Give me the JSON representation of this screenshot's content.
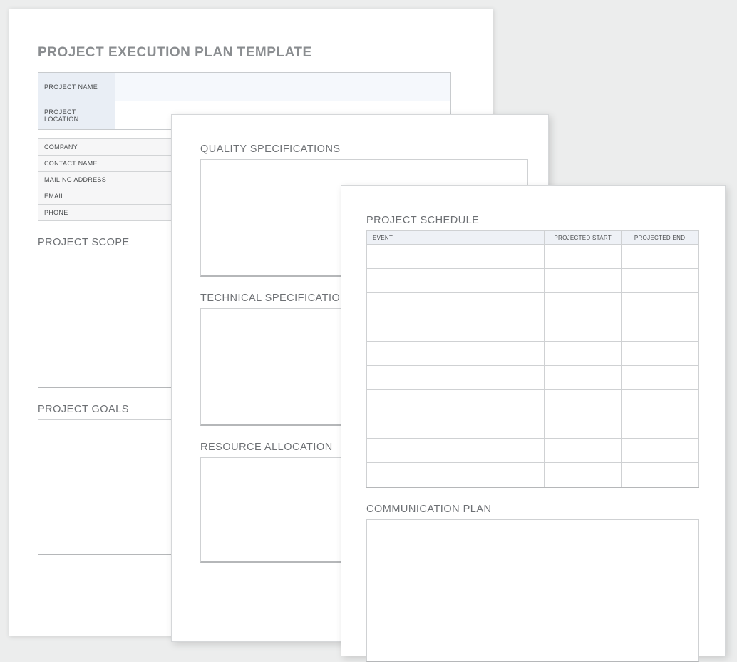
{
  "page1": {
    "title": "PROJECT EXECUTION PLAN TEMPLATE",
    "info": {
      "project_name_label": "PROJECT NAME",
      "project_name_value": "",
      "project_location_label": "PROJECT LOCATION",
      "project_location_value": ""
    },
    "contact": {
      "company_label": "COMPANY",
      "company_value": "",
      "contact_name_label": "CONTACT NAME",
      "contact_name_value": "",
      "mailing_address_label": "MAILING ADDRESS",
      "mailing_address_value": "",
      "email_label": "EMAIL",
      "email_value": "",
      "phone_label": "PHONE",
      "phone_value": ""
    },
    "scope_heading": "PROJECT SCOPE",
    "goals_heading": "PROJECT GOALS"
  },
  "page2": {
    "quality_heading": "QUALITY SPECIFICATIONS",
    "technical_heading": "TECHNICAL SPECIFICATIONS",
    "resource_heading": "RESOURCE ALLOCATION"
  },
  "page3": {
    "schedule_heading": "PROJECT SCHEDULE",
    "schedule_cols": {
      "event": "EVENT",
      "start": "PROJECTED START",
      "end": "PROJECTED END"
    },
    "schedule_rows": [
      {
        "event": "",
        "start": "",
        "end": ""
      },
      {
        "event": "",
        "start": "",
        "end": ""
      },
      {
        "event": "",
        "start": "",
        "end": ""
      },
      {
        "event": "",
        "start": "",
        "end": ""
      },
      {
        "event": "",
        "start": "",
        "end": ""
      },
      {
        "event": "",
        "start": "",
        "end": ""
      },
      {
        "event": "",
        "start": "",
        "end": ""
      },
      {
        "event": "",
        "start": "",
        "end": ""
      },
      {
        "event": "",
        "start": "",
        "end": ""
      },
      {
        "event": "",
        "start": "",
        "end": ""
      }
    ],
    "communication_heading": "COMMUNICATION PLAN"
  }
}
